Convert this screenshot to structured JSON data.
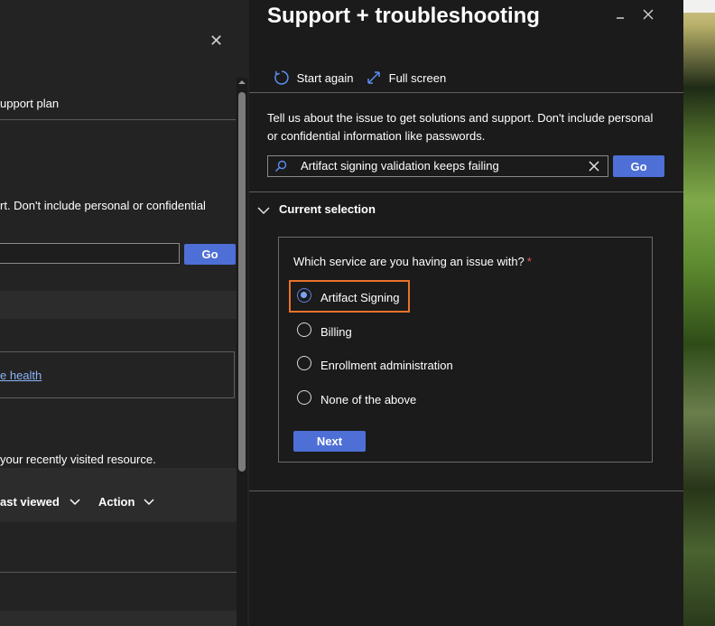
{
  "background_blade": {
    "support_plan_text": "upport plan",
    "description_fragment": "rt. Don't include personal or confidential",
    "go_label": "Go",
    "health_link": "e health",
    "recent_text": "your recently visited resource.",
    "col_last_viewed": "ast viewed",
    "col_action": "Action"
  },
  "panel": {
    "title": "Support + troubleshooting",
    "toolbar": {
      "start_again": "Start again",
      "full_screen": "Full screen"
    },
    "description": "Tell us about the issue to get solutions and support. Don't include personal or confidential information like passwords.",
    "search": {
      "value": "Artifact signing validation keeps failing"
    },
    "go_label": "Go",
    "section_label": "Current selection",
    "question": "Which service are you having an issue with?",
    "required_marker": "*",
    "options": [
      {
        "label": "Artifact Signing",
        "selected": true
      },
      {
        "label": "Billing",
        "selected": false
      },
      {
        "label": "Enrollment administration",
        "selected": false
      },
      {
        "label": "None of the above",
        "selected": false
      }
    ],
    "next_label": "Next"
  },
  "colors": {
    "accent": "#4d6fd6",
    "highlight": "#e8722b",
    "required": "#e05a5a"
  }
}
